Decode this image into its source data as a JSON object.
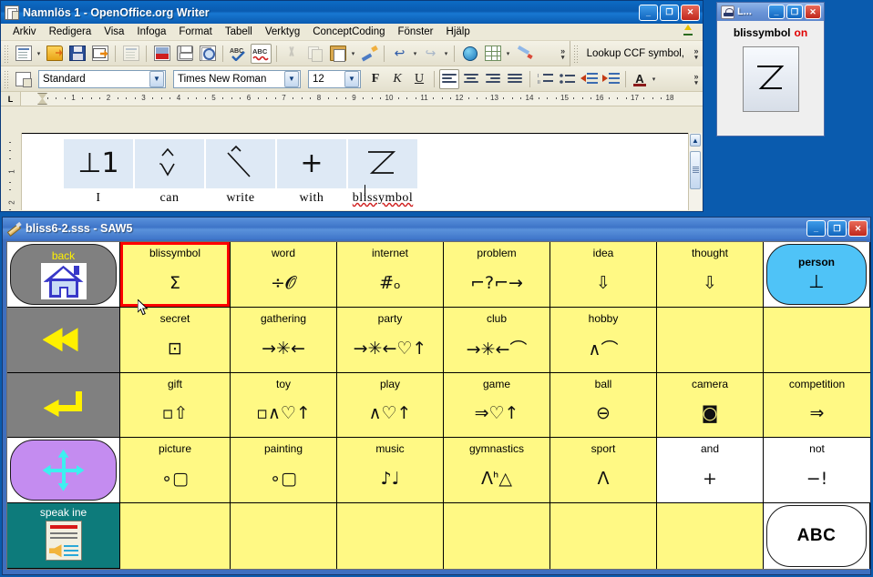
{
  "writer": {
    "title_bold": "Namnlös 1",
    "title_rest": " - OpenOffice.org Writer",
    "window_buttons": {
      "minimize": "_",
      "maximize": "❐",
      "close": "✕"
    },
    "menus": [
      "Arkiv",
      "Redigera",
      "Visa",
      "Infoga",
      "Format",
      "Tabell",
      "Verktyg",
      "ConceptCoding",
      "Fönster",
      "Hjälp"
    ],
    "toolbar_overflow": "»",
    "ccf_toolbar": {
      "field_value": "Lookup CCF symbol,"
    },
    "format_bar": {
      "style": "Standard",
      "font": "Times New Roman",
      "size": "12",
      "bold": "F",
      "italic": "K",
      "underline": "U"
    },
    "ruler": {
      "corner": "L",
      "h_labels": [
        "1",
        "2",
        "3",
        "4",
        "5",
        "6",
        "7",
        "8",
        "9",
        "10",
        "11",
        "12",
        "13",
        "14",
        "15",
        "16",
        "17",
        "18"
      ],
      "v_labels": [
        "1",
        "2"
      ]
    },
    "document": {
      "symbols": [
        {
          "glyph": "⊥1",
          "word": "I",
          "misspelled": false
        },
        {
          "glyph": "∨",
          "word": "can",
          "misspelled": false
        },
        {
          "glyph": "＼",
          "word": "write",
          "misspelled": false
        },
        {
          "glyph": "+",
          "word": "with",
          "misspelled": false
        },
        {
          "glyph": "Σ",
          "word": "blissymbol",
          "misspelled": true
        }
      ]
    },
    "scrollbar": {
      "up_arrow": "▲"
    }
  },
  "lookup_window": {
    "title": "L...",
    "window_buttons": {
      "minimize": "_",
      "maximize": "❐",
      "close": "✕"
    },
    "label": "blissymbol",
    "status": "on",
    "status_color": "#E00000",
    "symbol_glyph": "Σ"
  },
  "saw": {
    "title_bold": "bliss6-2.sss",
    "title_rest": " - SAW5",
    "window_buttons": {
      "minimize": "_",
      "maximize": "❐",
      "close": "✕"
    },
    "colors": {
      "cell_yellow": "#FFF984",
      "selected_border": "#FF0000",
      "person_cyan": "#4FC3F7",
      "nav_gray": "#808080",
      "speak_teal": "#0D7B7B",
      "move_purple": "#C48CF0"
    },
    "grid": [
      [
        {
          "kind": "pill-gray",
          "label": "back",
          "icon": "home-icon"
        },
        {
          "kind": "yellow",
          "label": "blissymbol",
          "glyph": "Σ",
          "selected": true
        },
        {
          "kind": "yellow",
          "label": "word",
          "glyph": "÷𝓞"
        },
        {
          "kind": "yellow",
          "label": "internet",
          "glyph": "#̄ₒ"
        },
        {
          "kind": "yellow",
          "label": "problem",
          "glyph": "⌐?⌐→"
        },
        {
          "kind": "yellow",
          "label": "idea",
          "glyph": "⇩"
        },
        {
          "kind": "yellow",
          "label": "thought",
          "glyph": "⇩"
        },
        {
          "kind": "pill-cyan",
          "label": "person",
          "glyph": "⊥"
        }
      ],
      [
        {
          "kind": "square-gray",
          "icon": "rewind-icon"
        },
        {
          "kind": "yellow",
          "label": "secret",
          "glyph": "⊡"
        },
        {
          "kind": "yellow",
          "label": "gathering",
          "glyph": "→✳←"
        },
        {
          "kind": "yellow",
          "label": "party",
          "glyph": "→✳←♡↑"
        },
        {
          "kind": "yellow",
          "label": "club",
          "glyph": "→✳←⌒"
        },
        {
          "kind": "yellow",
          "label": "hobby",
          "glyph": "∧⌒"
        },
        {
          "kind": "yellow",
          "label": "",
          "glyph": ""
        },
        {
          "kind": "yellow",
          "label": "",
          "glyph": ""
        }
      ],
      [
        {
          "kind": "square-gray",
          "icon": "enter-icon"
        },
        {
          "kind": "yellow",
          "label": "gift",
          "glyph": "▫⇧"
        },
        {
          "kind": "yellow",
          "label": "toy",
          "glyph": "▫∧♡↑"
        },
        {
          "kind": "yellow",
          "label": "play",
          "glyph": "∧♡↑"
        },
        {
          "kind": "yellow",
          "label": "game",
          "glyph": "⇒♡↑"
        },
        {
          "kind": "yellow",
          "label": "ball",
          "glyph": "⊖"
        },
        {
          "kind": "yellow",
          "label": "camera",
          "glyph": "◙"
        },
        {
          "kind": "yellow",
          "label": "competition",
          "glyph": "⇒"
        }
      ],
      [
        {
          "kind": "pill-purple",
          "icon": "four-way-arrows-icon"
        },
        {
          "kind": "yellow",
          "label": "picture",
          "glyph": "∘▢"
        },
        {
          "kind": "yellow",
          "label": "painting",
          "glyph": "∘▢"
        },
        {
          "kind": "yellow",
          "label": "music",
          "glyph": "♪♩"
        },
        {
          "kind": "yellow",
          "label": "gymnastics",
          "glyph": "ⴷᑋ△"
        },
        {
          "kind": "yellow",
          "label": "sport",
          "glyph": "ⴷ"
        },
        {
          "kind": "white",
          "label": "and",
          "glyph": "+"
        },
        {
          "kind": "white",
          "label": "not",
          "glyph": "−!"
        }
      ],
      [
        {
          "kind": "square-teal",
          "label": "speak ine",
          "icon": "speak-document-icon"
        },
        {
          "kind": "yellow",
          "label": "",
          "glyph": ""
        },
        {
          "kind": "yellow",
          "label": "",
          "glyph": ""
        },
        {
          "kind": "yellow",
          "label": "",
          "glyph": ""
        },
        {
          "kind": "yellow",
          "label": "",
          "glyph": ""
        },
        {
          "kind": "yellow",
          "label": "",
          "glyph": ""
        },
        {
          "kind": "yellow",
          "label": "",
          "glyph": ""
        },
        {
          "kind": "pill-white",
          "label": "",
          "glyph": "ABC"
        }
      ]
    ]
  }
}
